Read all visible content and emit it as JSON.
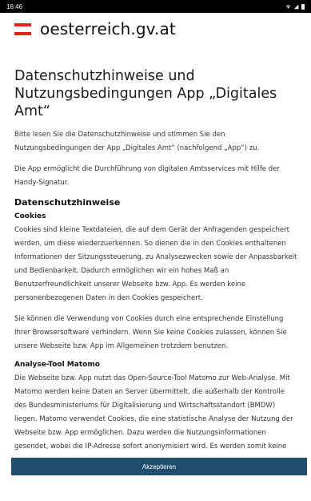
{
  "status_bar": {
    "time": "16:46"
  },
  "header": {
    "site_name": "oesterreich.gv.at"
  },
  "title": "Datenschutzhinweise und Nutzungsbedingungen App „Digitales Amt“",
  "intro": [
    "Bitte lesen Sie die Datenschutzhinweise und stimmen Sie den Nutzungsbedingungen der App „Digitales Amt“ (nachfolgend „App“) zu.",
    "Die App ermöglicht die Durchführung von digitalen Amtsservices mit Hilfe der Handy-Signatur."
  ],
  "privacy_heading": "Datenschutzhinweise",
  "cookies": {
    "heading": "Cookies",
    "paragraphs": [
      "Cookies sind kleine Textdateien, die auf dem Gerät der Anfragenden gespeichert werden, um diese wiederzuerkennen. So dienen die in den Cookies enthaltenen Informationen der Sitzungssteuerung, zu Analysezwecken sowie der Anpassbarkeit und Bedienbarkeit. Dadurch ermöglichen wir ein hohes Maß an Benutzerfreundlichkeit unserer Webseite bzw. App. Es werden keine personenbezogenen Daten in den Cookies gespeichert.",
      "Sie können die Verwendung von Cookies durch eine entsprechende Einstellung Ihrer Browsersoftware verhindern. Wenn Sie keine Cookies zulassen, können Sie unsere Webseite bzw. App im Allgemeinen trotzdem benutzen."
    ]
  },
  "matomo": {
    "heading": "Analyse-Tool Matomo",
    "paragraph": "Die Webseite bzw. App nutzt das Open-Source-Tool Matomo zur Web-Analyse. Mit Matomo werden keine Daten an Server übermittelt, die außerhalb der Kontrolle des Bundesministeriums für Digitalisierung und Wirtschaftsstandort (BMDW) liegen. Matomo verwendet Cookies, die eine statistische Analyse der Nutzung der Webseite bzw. App ermöglichen. Dazu werden die Nutzungsinformationen gesendet, wobei die IP-Adresse sofort anonymisiert wird. Es werden somit keine personenbezogenen Daten für statistische"
  },
  "accept_button": "Akzeptieren",
  "colors": {
    "brand_red": "#e2231a",
    "accept_bg": "#1f4f6e"
  }
}
